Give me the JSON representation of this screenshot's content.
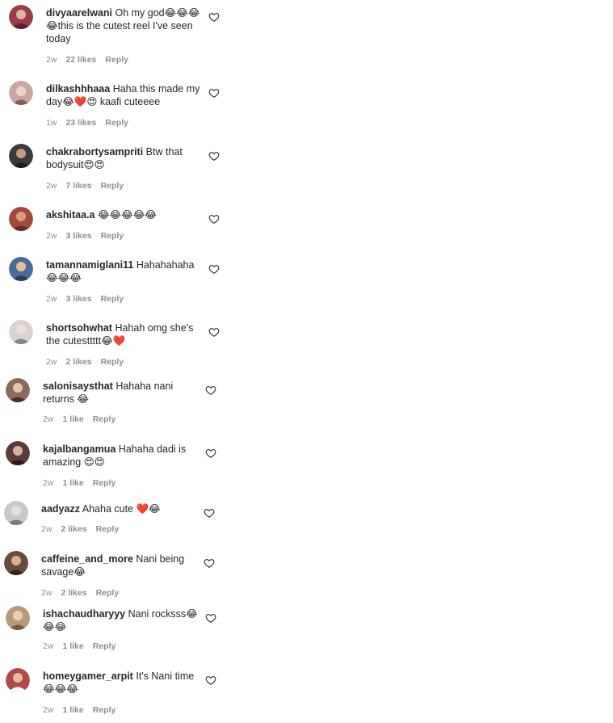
{
  "comments": [
    {
      "username": "divyaarelwani",
      "text": "Oh my god😂😂😂😂this is the cutest reel I've seen today",
      "time": "2w",
      "likes": "22 likes",
      "reply": "Reply",
      "avatar_color": "#9a3a4a"
    },
    {
      "username": "dilkashhhaaa",
      "text": "Haha this made my day😂❤️😍 kaafi cuteeee",
      "time": "1w",
      "likes": "23 likes",
      "reply": "Reply",
      "avatar_color": "#c9a6a0"
    },
    {
      "username": "chakrabortysampriti",
      "text": "Btw that bodysuit😍😍",
      "time": "2w",
      "likes": "7 likes",
      "reply": "Reply",
      "avatar_color": "#3a3a3a"
    },
    {
      "username": "akshitaa.a",
      "text": "😂😂😂😂😂",
      "time": "2w",
      "likes": "3 likes",
      "reply": "Reply",
      "avatar_color": "#a14a3c"
    },
    {
      "username": "tamannamiglani11",
      "text": "Hahahahaha 😂😂😂",
      "time": "2w",
      "likes": "3 likes",
      "reply": "Reply",
      "avatar_color": "#4a6a9a"
    },
    {
      "username": "shortsohwhat",
      "text": "Hahah omg she's the cutesttttt😂❤️",
      "time": "2w",
      "likes": "2 likes",
      "reply": "Reply",
      "avatar_color": "#d8d4d6"
    },
    {
      "username": "salonisaysthat",
      "text": "Hahaha nani returns 😂",
      "time": "2w",
      "likes": "1 like",
      "reply": "Reply",
      "avatar_color": "#8a6a5a"
    },
    {
      "username": "kajalbangamua",
      "text": "Hahaha dadi is amazing 😍😍",
      "time": "2w",
      "likes": "1 like",
      "reply": "Reply",
      "avatar_color": "#5a3a3a"
    },
    {
      "username": "aadyazz",
      "text": "Ahaha cute ❤️😂",
      "time": "2w",
      "likes": "2 likes",
      "reply": "Reply",
      "avatar_color": "#c8c8c8"
    },
    {
      "username": "caffeine_and_more",
      "text": "Nani being savage😂",
      "time": "2w",
      "likes": "2 likes",
      "reply": "Reply",
      "avatar_color": "#6a4a3a"
    },
    {
      "username": "ishachaudharyyy",
      "text": "Nani rocksss😂😂😂",
      "time": "2w",
      "likes": "1 like",
      "reply": "Reply",
      "avatar_color": "#b89a7a"
    },
    {
      "username": "homeygamer_arpit",
      "text": "It's Nani time 😂😂😂",
      "time": "2w",
      "likes": "1 like",
      "reply": "Reply",
      "avatar_color": "#b04a4a"
    }
  ]
}
